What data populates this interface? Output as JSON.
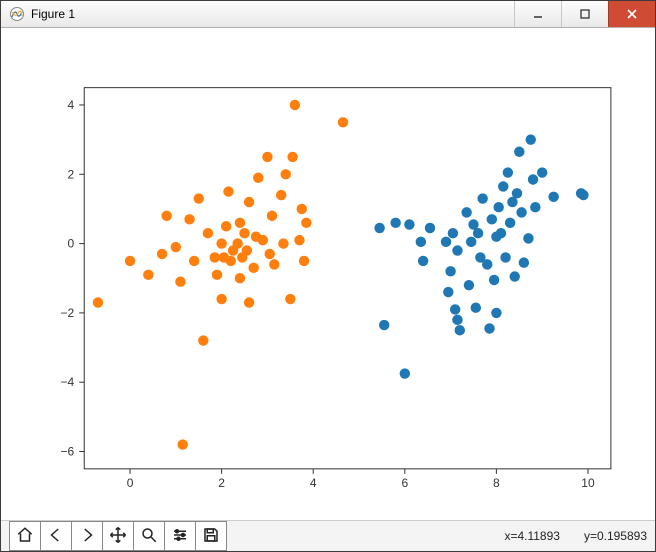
{
  "window": {
    "title": "Figure 1"
  },
  "toolbar_names": [
    "home",
    "back",
    "forward",
    "pan",
    "zoom",
    "configure",
    "save"
  ],
  "status": {
    "x_label": "x=4.11893",
    "y_label": "y=0.195893"
  },
  "chart_data": {
    "type": "scatter",
    "title": "",
    "xlabel": "",
    "ylabel": "",
    "xlim": [
      -1,
      10.5
    ],
    "ylim": [
      -6.5,
      4.5
    ],
    "xticks": [
      0,
      2,
      4,
      6,
      8,
      10
    ],
    "yticks": [
      -6,
      -4,
      -2,
      0,
      2,
      4
    ],
    "series": [
      {
        "name": "orange",
        "color": "#ff7f0e",
        "points": [
          [
            -0.7,
            -1.7
          ],
          [
            0.0,
            -0.5
          ],
          [
            0.4,
            -0.9
          ],
          [
            0.7,
            -0.3
          ],
          [
            0.8,
            0.8
          ],
          [
            1.0,
            -0.1
          ],
          [
            1.1,
            -1.1
          ],
          [
            1.15,
            -5.8
          ],
          [
            1.3,
            0.7
          ],
          [
            1.4,
            -0.5
          ],
          [
            1.5,
            1.3
          ],
          [
            1.6,
            -2.8
          ],
          [
            1.7,
            0.3
          ],
          [
            1.85,
            -0.4
          ],
          [
            1.9,
            -0.9
          ],
          [
            2.0,
            0.0
          ],
          [
            2.0,
            -1.6
          ],
          [
            2.05,
            -0.4
          ],
          [
            2.1,
            0.5
          ],
          [
            2.15,
            1.5
          ],
          [
            2.2,
            -0.5
          ],
          [
            2.25,
            -0.2
          ],
          [
            2.35,
            0.0
          ],
          [
            2.4,
            0.6
          ],
          [
            2.4,
            -1.0
          ],
          [
            2.45,
            -0.4
          ],
          [
            2.5,
            0.3
          ],
          [
            2.55,
            -0.2
          ],
          [
            2.6,
            1.2
          ],
          [
            2.6,
            -1.7
          ],
          [
            2.7,
            -0.7
          ],
          [
            2.75,
            0.2
          ],
          [
            2.8,
            1.9
          ],
          [
            2.9,
            0.1
          ],
          [
            3.0,
            2.5
          ],
          [
            3.05,
            -0.3
          ],
          [
            3.1,
            0.8
          ],
          [
            3.15,
            -0.6
          ],
          [
            3.3,
            1.4
          ],
          [
            3.35,
            0.0
          ],
          [
            3.4,
            2.0
          ],
          [
            3.5,
            -1.6
          ],
          [
            3.55,
            2.5
          ],
          [
            3.6,
            4.0
          ],
          [
            3.7,
            0.1
          ],
          [
            3.75,
            1.0
          ],
          [
            3.8,
            -0.5
          ],
          [
            3.85,
            0.6
          ],
          [
            4.65,
            3.5
          ]
        ]
      },
      {
        "name": "blue",
        "color": "#1f77b4",
        "points": [
          [
            5.45,
            0.45
          ],
          [
            5.55,
            -2.35
          ],
          [
            5.8,
            0.6
          ],
          [
            6.0,
            -3.75
          ],
          [
            6.1,
            0.55
          ],
          [
            6.35,
            0.05
          ],
          [
            6.4,
            -0.5
          ],
          [
            6.55,
            0.45
          ],
          [
            6.9,
            0.05
          ],
          [
            6.95,
            -1.4
          ],
          [
            7.0,
            -0.8
          ],
          [
            7.05,
            0.3
          ],
          [
            7.1,
            -1.9
          ],
          [
            7.15,
            -2.2
          ],
          [
            7.15,
            -0.2
          ],
          [
            7.2,
            -2.5
          ],
          [
            7.35,
            0.9
          ],
          [
            7.4,
            -1.2
          ],
          [
            7.45,
            0.05
          ],
          [
            7.5,
            0.55
          ],
          [
            7.55,
            -1.85
          ],
          [
            7.6,
            0.3
          ],
          [
            7.65,
            -0.4
          ],
          [
            7.7,
            1.3
          ],
          [
            7.8,
            -0.6
          ],
          [
            7.85,
            -2.45
          ],
          [
            7.9,
            0.7
          ],
          [
            7.95,
            -1.05
          ],
          [
            8.0,
            -2.0
          ],
          [
            8.0,
            0.2
          ],
          [
            8.05,
            1.05
          ],
          [
            8.1,
            0.3
          ],
          [
            8.15,
            1.65
          ],
          [
            8.2,
            -0.4
          ],
          [
            8.25,
            2.05
          ],
          [
            8.3,
            0.6
          ],
          [
            8.35,
            1.2
          ],
          [
            8.4,
            -0.95
          ],
          [
            8.45,
            1.45
          ],
          [
            8.5,
            2.65
          ],
          [
            8.55,
            0.9
          ],
          [
            8.6,
            -0.55
          ],
          [
            8.7,
            0.15
          ],
          [
            8.75,
            3.0
          ],
          [
            8.8,
            1.85
          ],
          [
            8.85,
            1.05
          ],
          [
            9.0,
            2.05
          ],
          [
            9.25,
            1.35
          ],
          [
            9.85,
            1.45
          ],
          [
            9.9,
            1.4
          ]
        ]
      }
    ]
  }
}
